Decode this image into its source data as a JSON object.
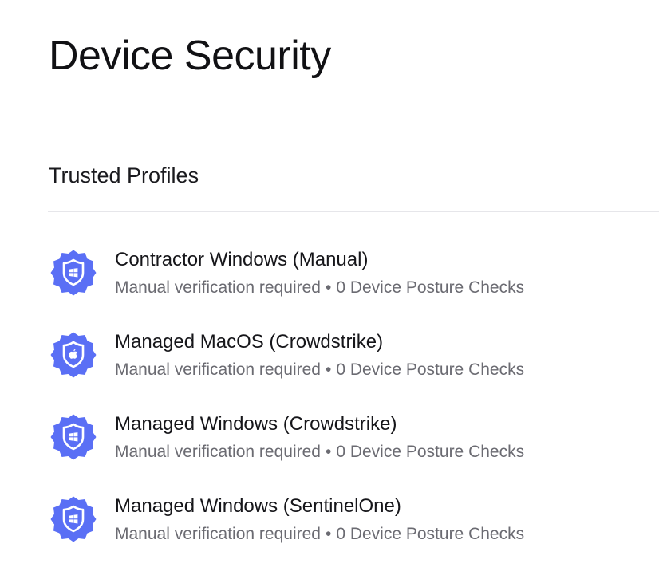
{
  "page": {
    "title": "Device Security"
  },
  "trusted_profiles": {
    "heading": "Trusted Profiles",
    "items": [
      {
        "name": "Contractor Windows (Manual)",
        "verification": "Manual verification required",
        "separator": "•",
        "checks": "0 Device Posture Checks",
        "icon": "windows-shield-badge-icon"
      },
      {
        "name": "Managed MacOS (Crowdstrike)",
        "verification": "Manual verification required",
        "separator": "•",
        "checks": "0 Device Posture Checks",
        "icon": "apple-shield-badge-icon"
      },
      {
        "name": "Managed Windows (Crowdstrike)",
        "verification": "Manual verification required",
        "separator": "•",
        "checks": "0 Device Posture Checks",
        "icon": "windows-shield-badge-icon"
      },
      {
        "name": "Managed Windows (SentinelOne)",
        "verification": "Manual verification required",
        "separator": "•",
        "checks": "0 Device Posture Checks",
        "icon": "windows-shield-badge-icon"
      }
    ]
  },
  "colors": {
    "badge_fill": "#5a6ff5",
    "badge_fill_dark": "#4a5ee8",
    "shield_stroke": "#ffffff",
    "title_text": "#111114",
    "meta_text": "#6b6b72",
    "divider": "#e6e6ea"
  }
}
